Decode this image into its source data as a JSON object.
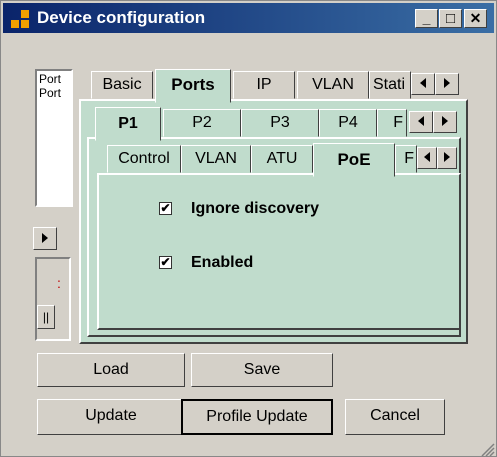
{
  "window": {
    "title": "Device configuration"
  },
  "titlebar_buttons": {
    "minimize": "_",
    "maximize": "□",
    "close": "✕"
  },
  "port_list": {
    "items": [
      "Port",
      "Port"
    ]
  },
  "side_fragment": {
    "label": ":"
  },
  "main_tabs": [
    {
      "label": "Basic",
      "active": false
    },
    {
      "label": "Ports",
      "active": true
    },
    {
      "label": "IP",
      "active": false
    },
    {
      "label": "VLAN",
      "active": false
    },
    {
      "label": "Stati",
      "active": false
    }
  ],
  "port_tabs": [
    {
      "label": "P1",
      "active": true
    },
    {
      "label": "P2",
      "active": false
    },
    {
      "label": "P3",
      "active": false
    },
    {
      "label": "P4",
      "active": false
    },
    {
      "label": "F",
      "active": false
    }
  ],
  "sub_tabs": [
    {
      "label": "Control",
      "active": false
    },
    {
      "label": "VLAN",
      "active": false
    },
    {
      "label": "ATU",
      "active": false
    },
    {
      "label": "PoE",
      "active": true
    },
    {
      "label": "F",
      "active": false
    }
  ],
  "poe": {
    "ignore_discovery": {
      "label": "Ignore discovery",
      "checked": true
    },
    "enabled": {
      "label": "Enabled",
      "checked": true
    }
  },
  "buttons": {
    "load": "Load",
    "save": "Save",
    "update": "Update",
    "profile_update": "Profile Update",
    "cancel": "Cancel"
  },
  "colors": {
    "title_bar_start": "#0a246a",
    "title_bar_end": "#3a6ea5",
    "active_tab": "#c0dccc",
    "face": "#d4d0c8"
  }
}
